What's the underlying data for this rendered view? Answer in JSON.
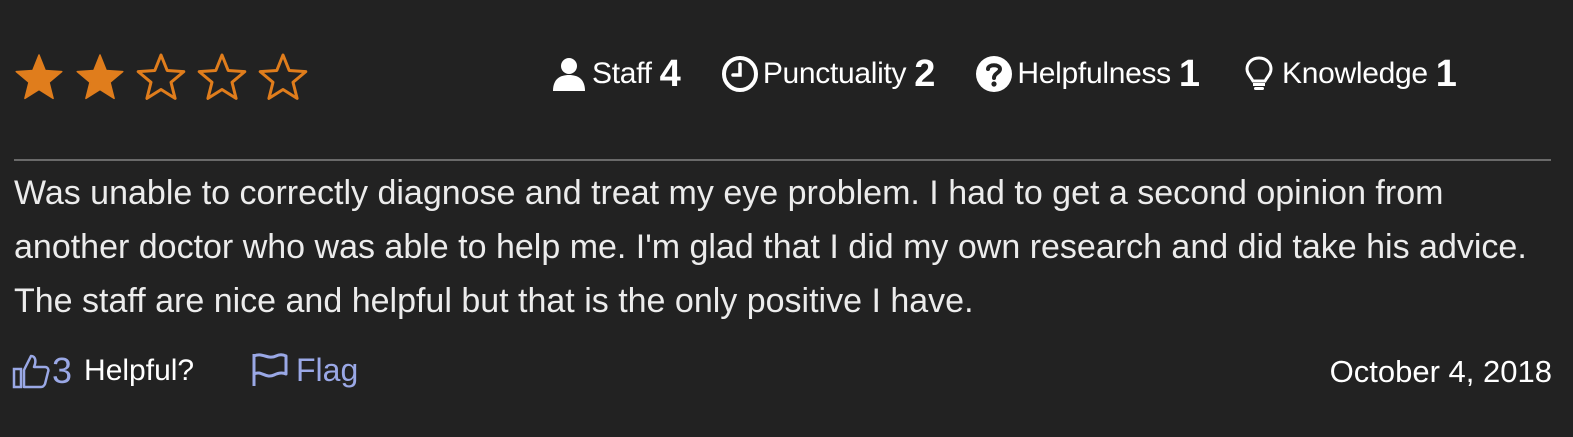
{
  "review": {
    "rating": 2,
    "rating_max": 5,
    "colors": {
      "star": "#e07d1c",
      "link": "#9aa8e6",
      "background": "#222222"
    },
    "criteria": [
      {
        "label": "Staff",
        "score": "4",
        "icon": "user-icon"
      },
      {
        "label": "Punctuality",
        "score": "2",
        "icon": "clock-icon"
      },
      {
        "label": "Helpfulness",
        "score": "1",
        "icon": "question-circle-icon"
      },
      {
        "label": "Knowledge",
        "score": "1",
        "icon": "lightbulb-icon"
      }
    ],
    "text": "Was unable to correctly diagnose and treat my eye problem. I had to get a second opinion from another doctor who was able to help me. I'm glad that I did my own research and did take his advice. The staff are nice and helpful but that is the only positive I have.",
    "helpful": {
      "icon": "thumbs-up-icon",
      "count": "3",
      "label": "Helpful?"
    },
    "flag": {
      "icon": "flag-icon",
      "label": "Flag"
    },
    "date": "October 4, 2018"
  }
}
